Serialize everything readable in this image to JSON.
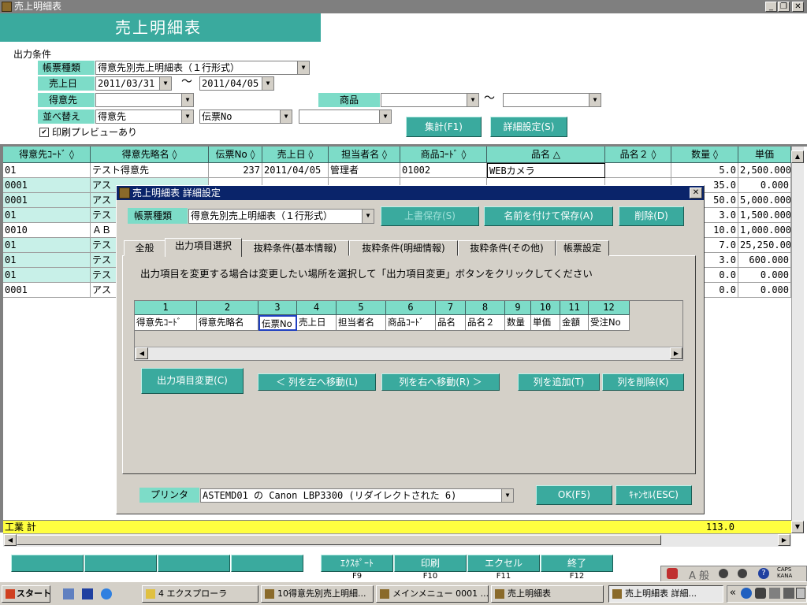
{
  "window": {
    "title": "売上明細表",
    "min": "_",
    "restore": "❐",
    "close": "✕"
  },
  "header": {
    "title": "売上明細表"
  },
  "conditions": {
    "section_label": "出力条件",
    "report_type": {
      "label": "帳票種類",
      "value": "得意先別売上明細表（１行形式）"
    },
    "sale_date": {
      "label": "売上日",
      "from": "2011/03/31",
      "tilde": "〜",
      "to": "2011/04/05"
    },
    "customer": {
      "label": "得意先",
      "value": ""
    },
    "product": {
      "label": "商品",
      "from": "",
      "tilde": "〜",
      "to": ""
    },
    "sort": {
      "label": "並べ替え",
      "v1": "得意先",
      "v2": "伝票No",
      "v3": ""
    },
    "preview": {
      "checkmark": "✔",
      "label": "印刷プレビューあり"
    },
    "aggregate_button": "集計(F1)",
    "detail_button": "詳細設定(S)"
  },
  "grid": {
    "headers": [
      "得意先ｺｰﾄﾞ ◊",
      "得意先略名 ◊",
      "伝票No ◊",
      "売上日 ◊",
      "担当者名 ◊",
      "商品ｺｰﾄﾞ ◊",
      "品名 △",
      "品名２ ◊",
      "数量 ◊",
      "単価"
    ],
    "rows": [
      [
        "01",
        "テスト得意先",
        "237",
        "2011/04/05",
        "管理者",
        "01002",
        "WEBカメラ",
        "",
        "5.0",
        "2,500.000"
      ],
      [
        "0001",
        "アス",
        "",
        "",
        "",
        "",
        "",
        "",
        "35.0",
        "0.000"
      ],
      [
        "0001",
        "アス",
        "",
        "",
        "",
        "",
        "",
        "",
        "50.0",
        "5,000.000"
      ],
      [
        "01",
        "テス",
        "",
        "",
        "",
        "",
        "",
        "",
        "3.0",
        "1,500.000"
      ],
      [
        "0010",
        "ＡＢ",
        "",
        "",
        "",
        "",
        "",
        "",
        "10.0",
        "1,000.000"
      ],
      [
        "01",
        "テス",
        "",
        "",
        "",
        "",
        "",
        "",
        "7.0",
        "25,250.000"
      ],
      [
        "01",
        "テス",
        "",
        "",
        "",
        "",
        "",
        "",
        "3.0",
        "600.000"
      ],
      [
        "01",
        "テス",
        "",
        "",
        "",
        "",
        "",
        "",
        "0.0",
        "0.000"
      ],
      [
        "0001",
        "アス",
        "",
        "",
        "",
        "",
        "",
        "",
        "0.0",
        "0.000"
      ]
    ],
    "total": {
      "label": "工業 計",
      "qty": "113.0"
    }
  },
  "dialog": {
    "title": "売上明細表 詳細設定",
    "close": "✕",
    "report_type_label": "帳票種類",
    "report_type_value": "得意先別売上明細表（１行形式）",
    "overwrite_save": "上書保存(S)",
    "save_as": "名前を付けて保存(A)",
    "delete": "削除(D)",
    "tabs": [
      "全般",
      "出力項目選択",
      "抜粋条件(基本情報)",
      "抜粋条件(明細情報)",
      "抜粋条件(その他)",
      "帳票設定"
    ],
    "instruction": "出力項目を変更する場合は変更したい場所を選択して「出力項目変更」ボタンをクリックしてください",
    "columns": [
      {
        "num": "1",
        "name": "得意先ｺｰﾄﾞ"
      },
      {
        "num": "2",
        "name": "得意先略名"
      },
      {
        "num": "3",
        "name": "伝票No"
      },
      {
        "num": "4",
        "name": "売上日"
      },
      {
        "num": "5",
        "name": "担当者名"
      },
      {
        "num": "6",
        "name": "商品ｺｰﾄﾞ"
      },
      {
        "num": "7",
        "name": "品名"
      },
      {
        "num": "8",
        "name": "品名２"
      },
      {
        "num": "9",
        "name": "数量"
      },
      {
        "num": "10",
        "name": "単価"
      },
      {
        "num": "11",
        "name": "金額"
      },
      {
        "num": "12",
        "name": "受注No"
      }
    ],
    "change_button": "出力項目変更(C)",
    "move_left": "＜ 列を左へ移動(L)",
    "move_right": "列を右へ移動(R) ＞",
    "add_column": "列を追加(T)",
    "delete_column": "列を削除(K)",
    "printer_label": "プリンタ",
    "printer_value": "ASTEMD01 の Canon LBP3300 (リダイレクトされた 6)",
    "ok": "OK(F5)",
    "cancel": "ｷｬﾝｾﾙ(ESC)"
  },
  "fkeys": [
    {
      "label": "ｴｸｽﾎﾟｰﾄ",
      "key": "F9"
    },
    {
      "label": "印刷",
      "key": "F10"
    },
    {
      "label": "エクセル",
      "key": "F11"
    },
    {
      "label": "終了",
      "key": "F12"
    }
  ],
  "ime": {
    "text": "A 般",
    "caps": "CAPS",
    "kana": "KANA"
  },
  "taskbar": {
    "start": "スタート",
    "items": [
      "4 エクスプローラ",
      "10得意先別売上明細...",
      "メインメニュー 0001 ...",
      "売上明細表",
      "売上明細表 詳細..."
    ],
    "tray": "«"
  }
}
